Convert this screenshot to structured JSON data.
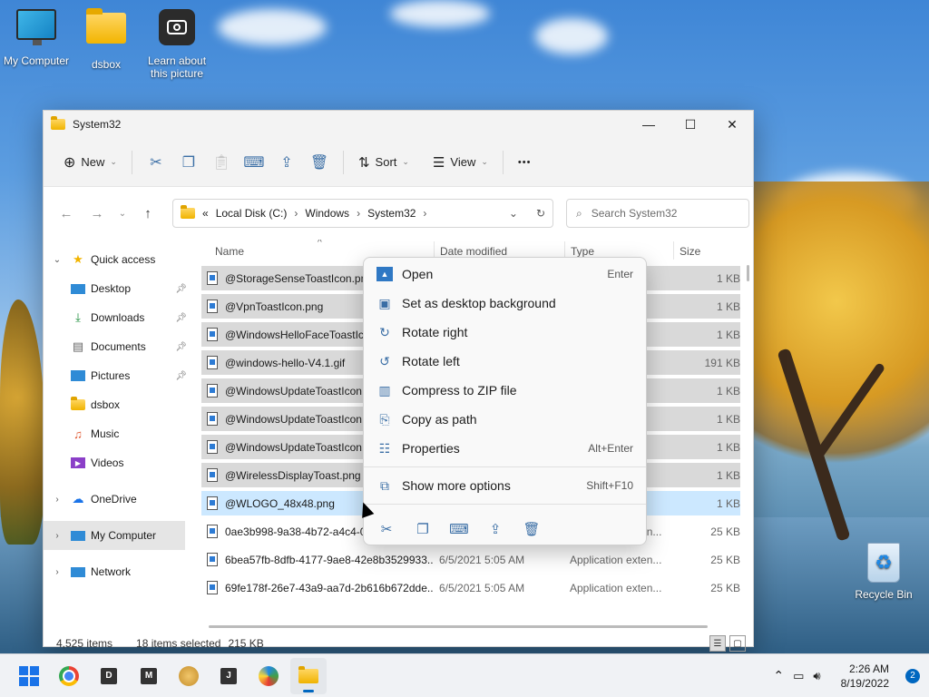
{
  "desktop": {
    "icons": [
      {
        "label": "My Computer"
      },
      {
        "label": "dsbox"
      },
      {
        "label": "Learn about this picture"
      },
      {
        "label": "Recycle Bin"
      }
    ]
  },
  "window": {
    "title": "System32",
    "controls": {
      "minimize": "—",
      "maximize": "☐",
      "close": "✕"
    }
  },
  "toolbar": {
    "new_label": "New",
    "sort_label": "Sort",
    "view_label": "View",
    "more_label": "•••"
  },
  "address": {
    "crumbs": [
      "Local Disk (C:)",
      "Windows",
      "System32"
    ],
    "overflow": "«",
    "search_placeholder": "Search System32"
  },
  "nav": {
    "quick_access": "Quick access",
    "items": [
      {
        "label": "Desktop",
        "icon": "desktop-icon",
        "pinned": true
      },
      {
        "label": "Downloads",
        "icon": "download-icon",
        "pinned": true
      },
      {
        "label": "Documents",
        "icon": "documents-icon",
        "pinned": true
      },
      {
        "label": "Pictures",
        "icon": "pictures-icon",
        "pinned": true
      },
      {
        "label": "dsbox",
        "icon": "folder-icon",
        "pinned": false
      },
      {
        "label": "Music",
        "icon": "music-icon",
        "pinned": false
      },
      {
        "label": "Videos",
        "icon": "videos-icon",
        "pinned": false
      }
    ],
    "onedrive": "OneDrive",
    "my_computer": "My Computer",
    "network": "Network"
  },
  "columns": {
    "name": "Name",
    "date": "Date modified",
    "type": "Type",
    "size": "Size"
  },
  "files": [
    {
      "name": "@StorageSenseToastIcon.png",
      "date": "",
      "type": "",
      "size": "1 KB",
      "state": "sel"
    },
    {
      "name": "@VpnToastIcon.png",
      "date": "",
      "type": "",
      "size": "1 KB",
      "state": "sel"
    },
    {
      "name": "@WindowsHelloFaceToastIcon.png",
      "date": "",
      "type": "",
      "size": "1 KB",
      "state": "sel"
    },
    {
      "name": "@windows-hello-V4.1.gif",
      "date": "",
      "type": "",
      "size": "191 KB",
      "state": "sel"
    },
    {
      "name": "@WindowsUpdateToastIcon.contrast-black.png",
      "date": "",
      "type": "",
      "size": "1 KB",
      "state": "sel"
    },
    {
      "name": "@WindowsUpdateToastIcon.contrast-white.png",
      "date": "",
      "type": "",
      "size": "1 KB",
      "state": "sel"
    },
    {
      "name": "@WindowsUpdateToastIcon.png",
      "date": "",
      "type": "",
      "size": "1 KB",
      "state": "sel"
    },
    {
      "name": "@WirelessDisplayToast.png",
      "date": "",
      "type": "",
      "size": "1 KB",
      "state": "sel"
    },
    {
      "name": "@WLOGO_48x48.png",
      "date": "",
      "type": "",
      "size": "1 KB",
      "state": "focus"
    },
    {
      "name": "0ae3b998-9a38-4b72-a4c4-06849441518d",
      "date": "",
      "type": "Application exten...",
      "size": "25 KB",
      "state": ""
    },
    {
      "name": "6bea57fb-8dfb-4177-9ae8-42e8b3529933...",
      "date": "6/5/2021 5:05 AM",
      "type": "Application exten...",
      "size": "25 KB",
      "state": ""
    },
    {
      "name": "69fe178f-26e7-43a9-aa7d-2b616b672dde...",
      "date": "6/5/2021 5:05 AM",
      "type": "Application exten...",
      "size": "25 KB",
      "state": ""
    }
  ],
  "status": {
    "count": "4,525 items",
    "selected": "18 items selected",
    "size": "215 KB"
  },
  "context_menu": {
    "items": [
      {
        "label": "Open",
        "shortcut": "Enter",
        "icon": "image-icon"
      },
      {
        "label": "Set as desktop background",
        "shortcut": "",
        "icon": "wallpaper-icon"
      },
      {
        "label": "Rotate right",
        "shortcut": "",
        "icon": "rotate-right-icon"
      },
      {
        "label": "Rotate left",
        "shortcut": "",
        "icon": "rotate-left-icon"
      },
      {
        "label": "Compress to ZIP file",
        "shortcut": "",
        "icon": "zip-icon"
      },
      {
        "label": "Copy as path",
        "shortcut": "",
        "icon": "copy-path-icon"
      },
      {
        "label": "Properties",
        "shortcut": "Alt+Enter",
        "icon": "properties-icon"
      }
    ],
    "more": {
      "label": "Show more options",
      "shortcut": "Shift+F10"
    }
  },
  "taskbar": {
    "apps": [
      "D",
      "M",
      "J"
    ],
    "time": "2:26 AM",
    "date": "8/19/2022",
    "notifications": "2"
  }
}
